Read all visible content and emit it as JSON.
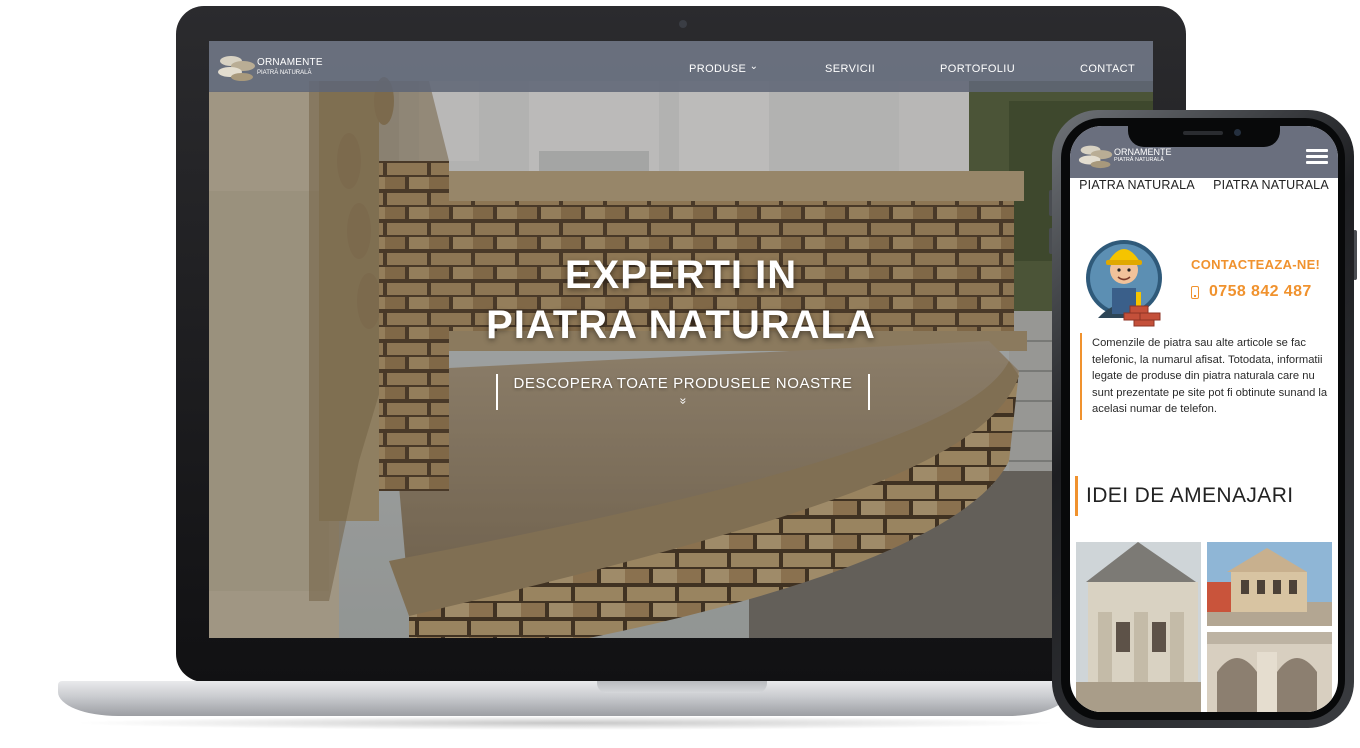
{
  "desktop": {
    "logo": {
      "title": "ORNAMENTE",
      "subtitle": "PIATRĂ NATURALĂ"
    },
    "nav": {
      "produse": "PRODUSE",
      "produse_caret": "⌄",
      "servicii": "SERVICII",
      "portofoliu": "PORTOFOLIU",
      "contact": "CONTACT"
    },
    "hero": {
      "title_line1": "EXPERTI IN",
      "title_line2": "PIATRA NATURALA",
      "cta_label": "DESCOPERA TOATE PRODUSELE NOASTRE",
      "cta_icon": "»"
    }
  },
  "mobile": {
    "logo": {
      "title": "ORNAMENTE",
      "subtitle": "PIATRĂ NATURALĂ"
    },
    "marquee": [
      "PIATRA NATURALA",
      "PIATRA NATURALA"
    ],
    "contact": {
      "title": "CONTACTEAZA-NE!",
      "phone": "0758 842 487"
    },
    "info_text": "Comenzile de piatra sau alte articole se fac telefonic, la numarul afisat. Totodata, informatii legate de produse din piatra naturala care nu sunt prezentate pe site pot fi obtinute sunand la acelasi numar de telefon.",
    "ideas_title": "IDEI DE AMENAJARI"
  },
  "colors": {
    "accent": "#f0922e",
    "nav_bg": "#6a6f7e",
    "text_dark": "#222222"
  },
  "icons": [
    "dropdown-caret-icon",
    "double-chevron-down-icon",
    "hamburger-menu-icon",
    "mobile-phone-icon",
    "stone-logo-icon",
    "worker-mascot-icon"
  ]
}
